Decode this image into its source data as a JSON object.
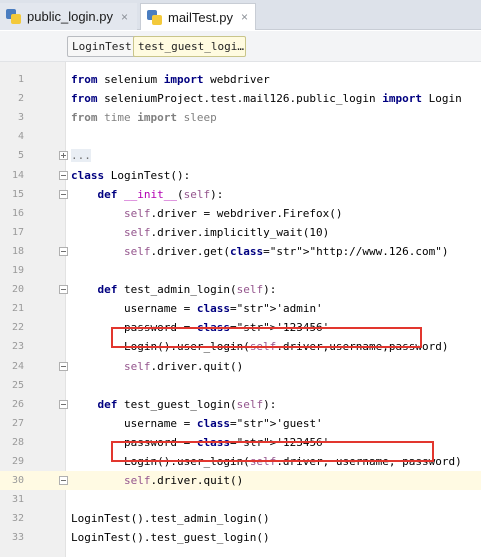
{
  "tabs": [
    {
      "label": "public_login.py",
      "close": "×"
    },
    {
      "label": "mailTest.py",
      "close": "×"
    }
  ],
  "breadcrumbs": [
    "LoginTest",
    "test_guest_logi…"
  ],
  "lines": [
    {
      "n": "1",
      "t": "from selenium import webdriver"
    },
    {
      "n": "2",
      "t": "from seleniumProject.test.mail126.public_login import Login"
    },
    {
      "n": "3",
      "t": "from time import sleep"
    },
    {
      "n": "4",
      "t": ""
    },
    {
      "n": "5",
      "t": "..."
    },
    {
      "n": "14",
      "t": "class LoginTest():"
    },
    {
      "n": "15",
      "t": "    def __init__(self):"
    },
    {
      "n": "16",
      "t": "        self.driver = webdriver.Firefox()"
    },
    {
      "n": "17",
      "t": "        self.driver.implicitly_wait(10)"
    },
    {
      "n": "18",
      "t": "        self.driver.get(\"http://www.126.com\")"
    },
    {
      "n": "19",
      "t": ""
    },
    {
      "n": "20",
      "t": "    def test_admin_login(self):"
    },
    {
      "n": "21",
      "t": "        username = 'admin'"
    },
    {
      "n": "22",
      "t": "        password = '123456'"
    },
    {
      "n": "23",
      "t": "        Login().user_login(self.driver,username,password)"
    },
    {
      "n": "24",
      "t": "        self.driver.quit()"
    },
    {
      "n": "25",
      "t": ""
    },
    {
      "n": "26",
      "t": "    def test_guest_login(self):"
    },
    {
      "n": "27",
      "t": "        username = 'guest'"
    },
    {
      "n": "28",
      "t": "        password = '123456'"
    },
    {
      "n": "29",
      "t": "        Login().user_login(self.driver, username, password)"
    },
    {
      "n": "30",
      "t": "        self.driver.quit()"
    },
    {
      "n": "31",
      "t": ""
    },
    {
      "n": "32",
      "t": "LoginTest().test_admin_login()"
    },
    {
      "n": "33",
      "t": "LoginTest().test_guest_login()"
    }
  ],
  "colors": {
    "keyword": "#000080",
    "string": "#008080",
    "self": "#94558d",
    "highlight_box": "#e2362e",
    "current_line": "#fffae3"
  }
}
